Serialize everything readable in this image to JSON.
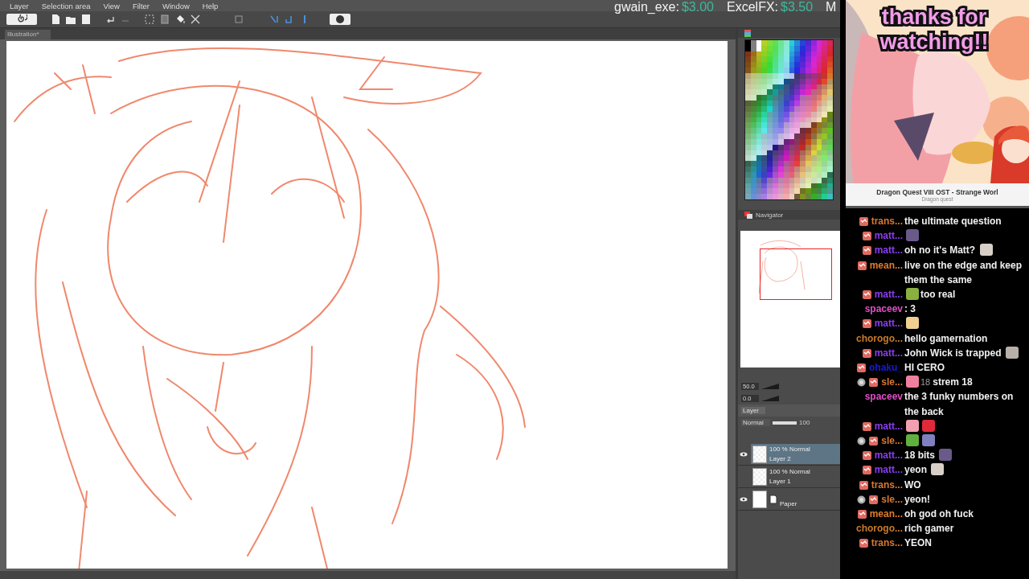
{
  "menu": [
    "Layer",
    "Selection area",
    "View",
    "Filter",
    "Window",
    "Help"
  ],
  "donations": [
    {
      "name": "gwain_exe:",
      "amount": "$3.00"
    },
    {
      "name": "ExcelFX:",
      "amount": "$3.50"
    },
    {
      "name": "M"
    }
  ],
  "document_tab": "Illustration*",
  "navigator": {
    "tab": "Navigator"
  },
  "layer_panel": {
    "zoom": "50.0",
    "rotation": "0.0",
    "tab": "Layer",
    "blend_mode": "Normal",
    "opacity_slider": {
      "level": 1
    },
    "opacity": "100",
    "layers": [
      {
        "info": "100 % Normal",
        "name": "Layer 2",
        "kind": "raster",
        "visible": true,
        "selected": true
      },
      {
        "info": "100 % Normal",
        "name": "Layer 1",
        "kind": "raster",
        "visible": false,
        "selected": false
      },
      {
        "name": "Paper",
        "kind": "paper",
        "visible": true,
        "selected": false
      }
    ]
  },
  "overlay": {
    "headline": "thanks for watching!!",
    "kind": "picture"
  },
  "now_playing": {
    "title": "Dragon Quest VIII OST - Strange Worl",
    "artist": "Dragon quest"
  },
  "chat": [
    {
      "user": "trans...",
      "color": "#d9772e",
      "sub_badge": true,
      "bits_badge": false,
      "parts": [
        {
          "kind": "text",
          "text": "the ultimate question"
        }
      ]
    },
    {
      "user": "matt...",
      "color": "#8a3cf0",
      "sub_badge": true,
      "bits_badge": false,
      "parts": [
        {
          "kind": "emote"
        }
      ]
    },
    {
      "user": "matt...",
      "color": "#8a3cf0",
      "sub_badge": true,
      "bits_badge": false,
      "parts": [
        {
          "kind": "text",
          "text": "oh no it's Matt?"
        },
        {
          "kind": "emote"
        }
      ]
    },
    {
      "user": "mean...",
      "color": "#e07b2a",
      "sub_badge": true,
      "bits_badge": false,
      "parts": [
        {
          "kind": "text",
          "text": "live on the edge and keep them the same"
        }
      ]
    },
    {
      "user": "matt...",
      "color": "#8a3cf0",
      "sub_badge": true,
      "bits_badge": false,
      "parts": [
        {
          "kind": "emote"
        },
        {
          "kind": "text",
          "text": "too real"
        }
      ]
    },
    {
      "user": "spaceev",
      "color": "#e050c8",
      "sub_badge": false,
      "bits_badge": false,
      "parts": [
        {
          "kind": "text",
          "text": ": 3"
        }
      ]
    },
    {
      "user": "matt...",
      "color": "#8a3cf0",
      "sub_badge": true,
      "bits_badge": false,
      "parts": [
        {
          "kind": "emote"
        }
      ]
    },
    {
      "user": "chorogo...",
      "color": "#c97a2a",
      "sub_badge": false,
      "bits_badge": false,
      "parts": [
        {
          "kind": "text",
          "text": "hello gamernation"
        }
      ]
    },
    {
      "user": "matt...",
      "color": "#8a3cf0",
      "sub_badge": true,
      "bits_badge": false,
      "parts": [
        {
          "kind": "text",
          "text": "John Wick is trapped"
        },
        {
          "kind": "emote"
        }
      ]
    },
    {
      "user": "ohaku_",
      "color": "#1a1ad0",
      "sub_badge": true,
      "bits_badge": false,
      "parts": [
        {
          "kind": "text",
          "text": "HI CERO"
        }
      ]
    },
    {
      "user": "sle...",
      "color": "#d9772e",
      "sub_badge": true,
      "bits_badge": true,
      "parts": [
        {
          "kind": "emote"
        },
        {
          "kind": "cheer",
          "text": "18"
        },
        {
          "kind": "text",
          "text": "strem 18"
        }
      ]
    },
    {
      "user": "spaceev",
      "color": "#e050c8",
      "sub_badge": false,
      "bits_badge": false,
      "parts": [
        {
          "kind": "text",
          "text": "the 3 funky numbers on the back"
        }
      ]
    },
    {
      "user": "matt...",
      "color": "#8a3cf0",
      "sub_badge": true,
      "bits_badge": false,
      "parts": [
        {
          "kind": "emote"
        },
        {
          "kind": "emote"
        }
      ]
    },
    {
      "user": "sle...",
      "color": "#d9772e",
      "sub_badge": true,
      "bits_badge": true,
      "parts": [
        {
          "kind": "emote"
        },
        {
          "kind": "emote"
        }
      ]
    },
    {
      "user": "matt...",
      "color": "#8a3cf0",
      "sub_badge": true,
      "bits_badge": false,
      "parts": [
        {
          "kind": "text",
          "text": "18 bits"
        },
        {
          "kind": "emote"
        }
      ]
    },
    {
      "user": "matt...",
      "color": "#8a3cf0",
      "sub_badge": true,
      "bits_badge": false,
      "parts": [
        {
          "kind": "text",
          "text": "yeon"
        },
        {
          "kind": "emote"
        }
      ]
    },
    {
      "user": "trans...",
      "color": "#d9772e",
      "sub_badge": true,
      "bits_badge": false,
      "parts": [
        {
          "kind": "text",
          "text": "WO"
        }
      ]
    },
    {
      "user": "sle...",
      "color": "#d9772e",
      "sub_badge": true,
      "bits_badge": true,
      "parts": [
        {
          "kind": "text",
          "text": "yeon!"
        }
      ]
    },
    {
      "user": "mean...",
      "color": "#e07b2a",
      "sub_badge": true,
      "bits_badge": false,
      "parts": [
        {
          "kind": "text",
          "text": "oh god oh fuck"
        }
      ]
    },
    {
      "user": "chorogo...",
      "color": "#c97a2a",
      "sub_badge": false,
      "bits_badge": false,
      "parts": [
        {
          "kind": "text",
          "text": "rich gamer"
        }
      ]
    },
    {
      "user": "trans...",
      "color": "#d9772e",
      "sub_badge": true,
      "bits_badge": false,
      "parts": [
        {
          "kind": "text",
          "text": "YEON"
        }
      ]
    }
  ]
}
